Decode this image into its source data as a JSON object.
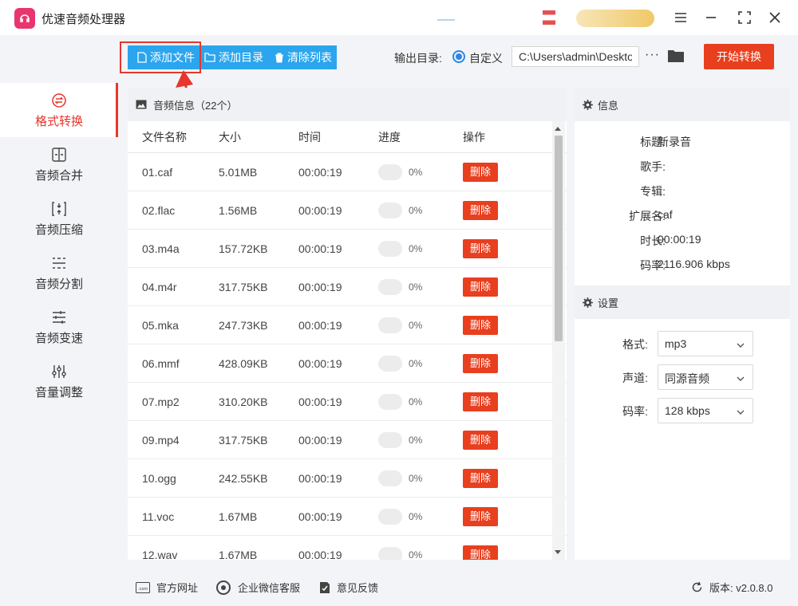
{
  "app": {
    "title": "优速音频处理器"
  },
  "toolbar": {
    "add_file": "添加文件",
    "add_dir": "添加目录",
    "clear_list": "清除列表",
    "output_label": "输出目录:",
    "radio_label": "自定义",
    "output_path": "C:\\Users\\admin\\Desktop",
    "more": "···",
    "start": "开始转换"
  },
  "sidebar": {
    "items": [
      {
        "label": "格式转换",
        "icon": "format-convert-icon",
        "active": true
      },
      {
        "label": "音频合并",
        "icon": "merge-icon"
      },
      {
        "label": "音频压缩",
        "icon": "compress-icon"
      },
      {
        "label": "音频分割",
        "icon": "split-icon"
      },
      {
        "label": "音频变速",
        "icon": "speed-icon"
      },
      {
        "label": "音量调整",
        "icon": "volume-icon"
      }
    ]
  },
  "list": {
    "header": "音频信息（22个）",
    "columns": {
      "name": "文件名称",
      "size": "大小",
      "time": "时间",
      "progress": "进度",
      "action": "操作"
    },
    "delete_label": "删除",
    "rows": [
      {
        "name": "01.caf",
        "size": "5.01MB",
        "time": "00:00:19",
        "progress": "0%"
      },
      {
        "name": "02.flac",
        "size": "1.56MB",
        "time": "00:00:19",
        "progress": "0%"
      },
      {
        "name": "03.m4a",
        "size": "157.72KB",
        "time": "00:00:19",
        "progress": "0%"
      },
      {
        "name": "04.m4r",
        "size": "317.75KB",
        "time": "00:00:19",
        "progress": "0%"
      },
      {
        "name": "05.mka",
        "size": "247.73KB",
        "time": "00:00:19",
        "progress": "0%"
      },
      {
        "name": "06.mmf",
        "size": "428.09KB",
        "time": "00:00:19",
        "progress": "0%"
      },
      {
        "name": "07.mp2",
        "size": "310.20KB",
        "time": "00:00:19",
        "progress": "0%"
      },
      {
        "name": "09.mp4",
        "size": "317.75KB",
        "time": "00:00:19",
        "progress": "0%"
      },
      {
        "name": "10.ogg",
        "size": "242.55KB",
        "time": "00:00:19",
        "progress": "0%"
      },
      {
        "name": "11.voc",
        "size": "1.67MB",
        "time": "00:00:19",
        "progress": "0%"
      },
      {
        "name": "12.wav",
        "size": "1.67MB",
        "time": "00:00:19",
        "progress": "0%"
      }
    ]
  },
  "info": {
    "header": "信息",
    "rows": [
      {
        "key": "标题:",
        "value": "新录音"
      },
      {
        "key": "歌手:",
        "value": ""
      },
      {
        "key": "专辑:",
        "value": ""
      },
      {
        "key": "扩展名:",
        "value": "caf"
      },
      {
        "key": "时长:",
        "value": "00:00:19"
      },
      {
        "key": "码率:",
        "value": "2116.906 kbps"
      }
    ]
  },
  "settings": {
    "header": "设置",
    "rows": [
      {
        "key": "格式:",
        "value": "mp3"
      },
      {
        "key": "声道:",
        "value": "同源音频"
      },
      {
        "key": "码率:",
        "value": "128 kbps"
      }
    ]
  },
  "footer": {
    "website": "官方网址",
    "wechat": "企业微信客服",
    "feedback": "意见反馈",
    "version": "版本: v2.0.8.0"
  },
  "colors": {
    "accent_red": "#e83f1f",
    "accent_blue": "#2ba5ee",
    "active_text": "#e5372d"
  }
}
